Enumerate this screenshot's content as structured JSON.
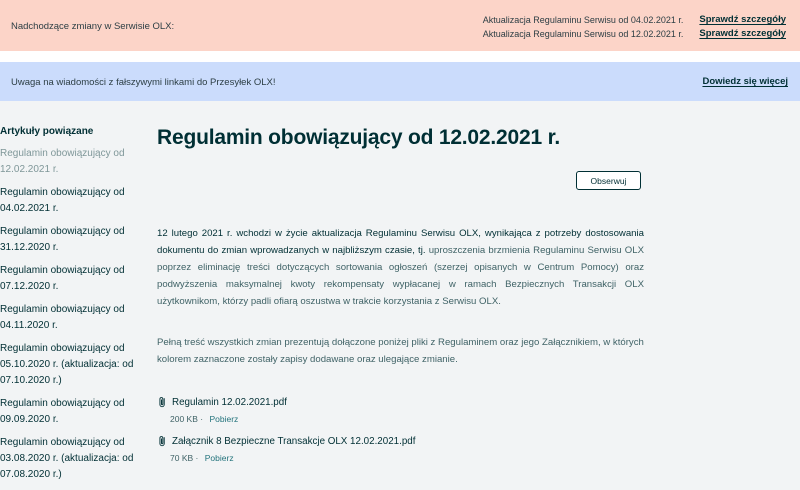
{
  "top_banner": {
    "lead": "Nadchodzące zmiany w Serwisie OLX:",
    "rows": [
      {
        "text": "Aktualizacja Regulaminu Serwisu od 04.02.2021 r.",
        "link": "Sprawdź szczegóły"
      },
      {
        "text": "Aktualizacja Regulaminu Serwisu od 12.02.2021 r.",
        "link": "Sprawdź szczegóły"
      }
    ]
  },
  "info_banner": {
    "lead": "Uwaga na wiadomości z fałszywymi linkami do Przesyłek OLX!",
    "link": "Dowiedz się więcej"
  },
  "sidebar": {
    "heading": "Artykuły powiązane",
    "items": [
      "Regulamin obowiązujący od 12.02.2021 r.",
      "Regulamin obowiązujący od 04.02.2021 r.",
      "Regulamin obowiązujący od 31.12.2020 r.",
      "Regulamin obowiązujący od 07.12.2020 r.",
      "Regulamin obowiązujący od 04.11.2020 r.",
      "Regulamin obowiązujący od 05.10.2020 r. (aktualizacja: od 07.10.2020 r.)",
      "Regulamin obowiązujący od 09.09.2020 r.",
      "Regulamin obowiązujący od 03.08.2020 r. (aktualizacja: od 07.08.2020 r.)"
    ]
  },
  "article": {
    "title": "Regulamin obowiązujący od 12.02.2021 r.",
    "follow_label": "Obserwuj",
    "para1_bold": "12 lutego 2021 r. wchodzi w życie aktualizacja Regulaminu Serwisu OLX, wynikająca z potrzeby dostosowania dokumentu do zmian wprowadzanych w najbliższym czasie, tj.",
    "para1_rest": " uproszczenia brzmienia Regulaminu Serwisu OLX poprzez eliminację treści dotyczących sortowania ogłoszeń (szerzej opisanych w Centrum Pomocy) oraz podwyższenia maksymalnej kwoty rekompensaty wypłacanej w ramach Bezpiecznych Transakcji OLX użytkownikom, którzy padli ofiarą oszustwa w trakcie korzystania z Serwisu OLX.",
    "para2": "Pełną treść wszystkich zmian prezentują dołączone poniżej pliki z Regulaminem oraz jego Załącznikiem, w których kolorem zaznaczone zostały zapisy dodawane oraz ulegające zmianie.",
    "files": [
      {
        "name": "Regulamin 12.02.2021.pdf",
        "size": "200 KB",
        "sep": "·",
        "download": "Pobierz"
      },
      {
        "name": "Załącznik 8 Bezpieczne Transakcje OLX 12.02.2021.pdf",
        "size": "70 KB",
        "sep": "·",
        "download": "Pobierz"
      }
    ]
  }
}
